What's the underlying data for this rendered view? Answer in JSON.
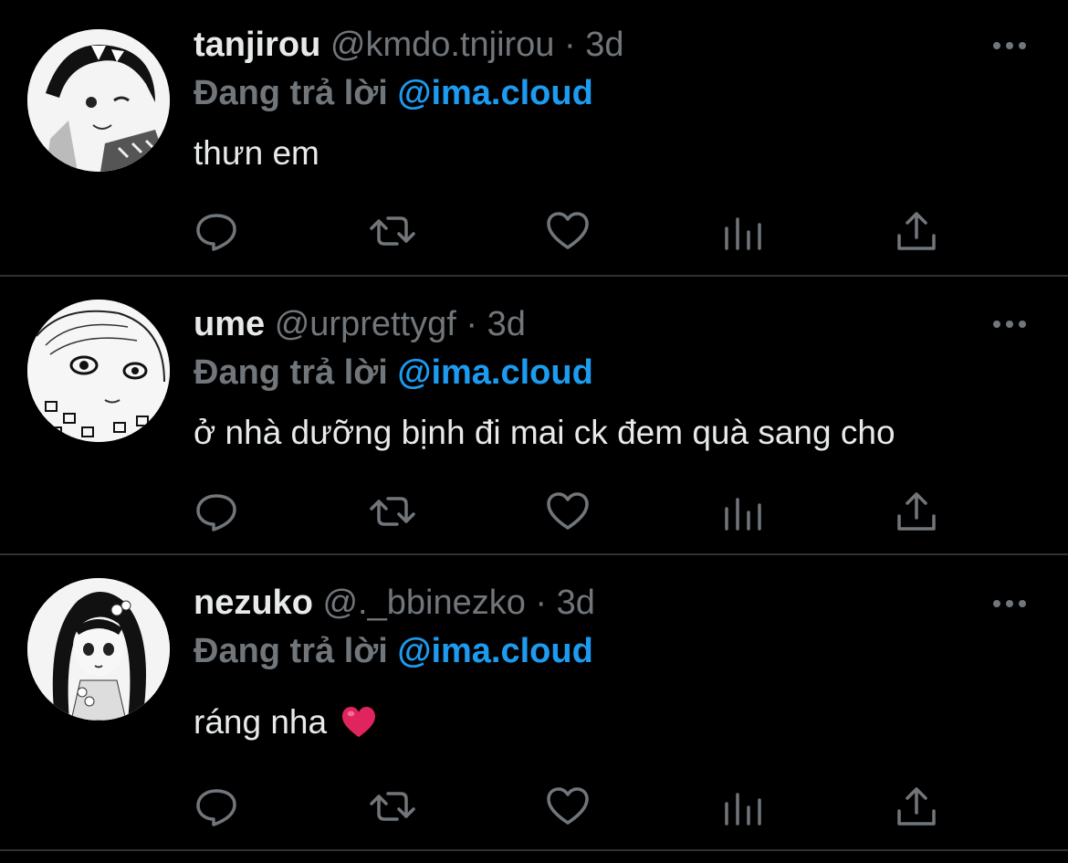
{
  "tweets": [
    {
      "name": "tanjirou",
      "handle": "@kmdo.tnjirou",
      "separator": "·",
      "time": "3d",
      "reply_prefix": "Đang trả lời",
      "reply_to": "@ima.cloud",
      "text": "thưn em",
      "emoji": ""
    },
    {
      "name": "ume",
      "handle": "@urprettygf",
      "separator": "·",
      "time": "3d",
      "reply_prefix": "Đang trả lời",
      "reply_to": "@ima.cloud",
      "text": "ở nhà dưỡng bịnh đi mai ck đem quà sang cho",
      "emoji": ""
    },
    {
      "name": "nezuko",
      "handle": "@._bbinezko",
      "separator": "·",
      "time": "3d",
      "reply_prefix": "Đang trả lời",
      "reply_to": "@ima.cloud",
      "text": "ráng nha",
      "emoji": "heart"
    }
  ],
  "icons": {
    "reply": "reply-icon",
    "retweet": "retweet-icon",
    "like": "like-icon",
    "analytics": "analytics-icon",
    "share": "share-icon",
    "more": "more-options-icon"
  },
  "colors": {
    "background": "#000000",
    "text": "#e7e9ea",
    "muted": "#71767b",
    "mention": "#1d9bf0",
    "divider": "#2f3336",
    "heart": "#e0245e"
  }
}
